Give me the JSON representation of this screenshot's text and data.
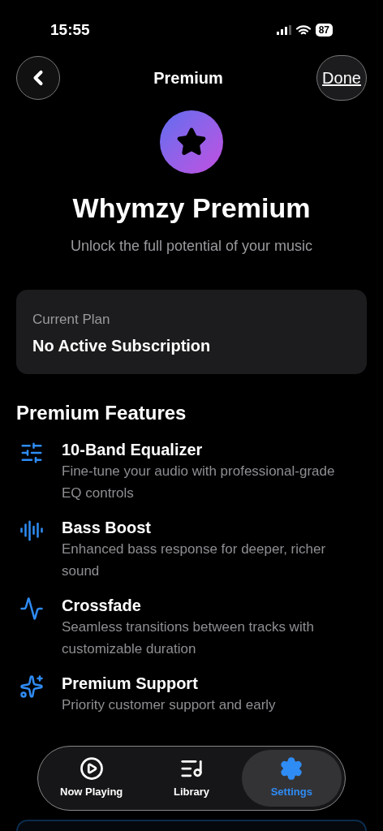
{
  "status_bar": {
    "time": "15:55",
    "battery": "87"
  },
  "nav": {
    "title": "Premium",
    "done": "Done"
  },
  "hero": {
    "title": "Whymzy Premium",
    "subtitle": "Unlock the full potential of your music"
  },
  "current_plan": {
    "label": "Current Plan",
    "value": "No Active Subscription"
  },
  "features_heading": "Premium Features",
  "features": [
    {
      "kind": "equalizer",
      "title": "10-Band Equalizer",
      "description": "Fine-tune your audio with professional-grade EQ controls"
    },
    {
      "kind": "bass",
      "title": "Bass Boost",
      "description": "Enhanced bass response for deeper, richer sound"
    },
    {
      "kind": "crossfade",
      "title": "Crossfade",
      "description": "Seamless transitions between tracks with customizable duration"
    },
    {
      "kind": "support",
      "title": "Premium Support",
      "description": "Priority customer support and early"
    }
  ],
  "tab_bar": [
    {
      "kind": "play",
      "label": "Now Playing",
      "selected": false
    },
    {
      "kind": "library",
      "label": "Library",
      "selected": false
    },
    {
      "kind": "settings",
      "label": "Settings",
      "selected": true
    }
  ]
}
